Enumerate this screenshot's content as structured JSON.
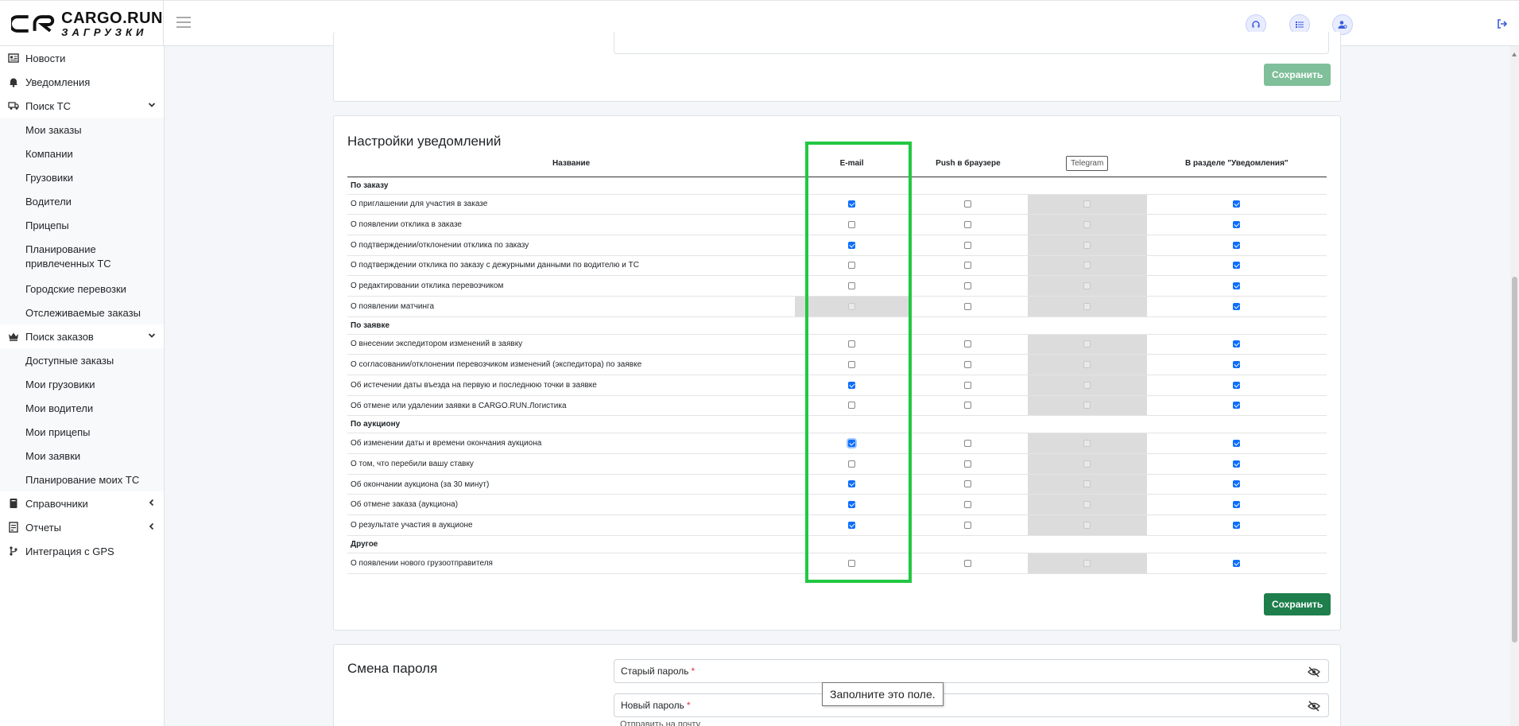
{
  "brand": {
    "name": "CARGO.RUN",
    "subtitle": "ЗАГРУЗКИ"
  },
  "sidebar": {
    "items": [
      {
        "label": "Новости",
        "icon": "newspaper-icon"
      },
      {
        "label": "Уведомления",
        "icon": "bell-icon"
      },
      {
        "label": "Поиск ТС",
        "icon": "truck-icon",
        "expanded": true,
        "children": [
          "Мои заказы",
          "Компании",
          "Грузовики",
          "Водители",
          "Прицепы",
          "Планирование привлеченных ТС",
          "Городские перевозки",
          "Отслеживаемые заказы"
        ]
      },
      {
        "label": "Поиск заказов",
        "icon": "crown-icon",
        "expanded": true,
        "children": [
          "Доступные заказы",
          "Мои грузовики",
          "Мои водители",
          "Мои прицепы",
          "Мои заявки",
          "Планирование моих ТС"
        ]
      },
      {
        "label": "Справочники",
        "icon": "book-icon"
      },
      {
        "label": "Отчеты",
        "icon": "report-icon"
      },
      {
        "label": "Интеграция с GPS",
        "icon": "gps-icon"
      }
    ]
  },
  "topbar": {
    "icons": [
      "headset-icon",
      "list-icon",
      "user-settings-icon"
    ],
    "logout_icon": "logout-icon"
  },
  "save_label": "Сохранить",
  "notifications": {
    "title": "Настройки уведомлений",
    "columns": {
      "name": "Название",
      "email": "E-mail",
      "push": "Push в браузере",
      "telegram": "Telegram",
      "section": "В разделе \"Уведомления\""
    },
    "groups": [
      {
        "title": "По заказу",
        "rows": [
          {
            "name": "О приглашении для участия в заказе",
            "email": true,
            "push": false,
            "section": true
          },
          {
            "name": "О появлении отклика в заказе",
            "email": false,
            "push": false,
            "section": true
          },
          {
            "name": "О подтверждении/отклонении отклика по заказу",
            "email": true,
            "push": false,
            "section": true
          },
          {
            "name": "О подтверждении отклика по заказу с дежурными данными по водителю и ТС",
            "email": false,
            "push": false,
            "section": true
          },
          {
            "name": "О редактировании отклика перевозчиком",
            "email": false,
            "push": false,
            "section": true
          },
          {
            "name": "О появлении матчинга",
            "email": false,
            "email_disabled": true,
            "push": false,
            "section": true
          }
        ]
      },
      {
        "title": "По заявке",
        "rows": [
          {
            "name": "О внесении экспедитором изменений в заявку",
            "email": false,
            "push": false,
            "section": true
          },
          {
            "name": "О согласовании/отклонении перевозчиком изменений (экспедитора) по заявке",
            "email": false,
            "push": false,
            "section": true
          },
          {
            "name": "Об истечении даты въезда на первую и последнюю точки в заявке",
            "email": true,
            "push": false,
            "section": true
          },
          {
            "name": "Об отмене или удалении заявки в CARGO.RUN.Логистика",
            "email": false,
            "push": false,
            "section": true
          }
        ]
      },
      {
        "title": "По аукциону",
        "rows": [
          {
            "name": "Об изменении даты и времени окончания аукциона",
            "email": true,
            "email_focus": true,
            "push": false,
            "section": true
          },
          {
            "name": "О том, что перебили вашу ставку",
            "email": false,
            "push": false,
            "section": true
          },
          {
            "name": "Об окончании аукциона (за 30 минут)",
            "email": true,
            "push": false,
            "section": true
          },
          {
            "name": "Об отмене заказа (аукциона)",
            "email": true,
            "push": false,
            "section": true
          },
          {
            "name": "О результате участия в аукционе",
            "email": true,
            "push": false,
            "section": true
          }
        ]
      },
      {
        "title": "Другое",
        "rows": [
          {
            "name": "О появлении нового грузоотправителя",
            "email": false,
            "push": false,
            "section": true
          }
        ]
      }
    ]
  },
  "password": {
    "title": "Смена пароля",
    "old_label": "Старый пароль",
    "new_label": "Новый пароль",
    "required_mark": "*",
    "tooltip": "Заполните это поле.",
    "cutoff_text": "Отправить на почту"
  },
  "colors": {
    "accent": "#0d6efd",
    "save": "#1e7e4c",
    "highlight": "#22c742"
  }
}
